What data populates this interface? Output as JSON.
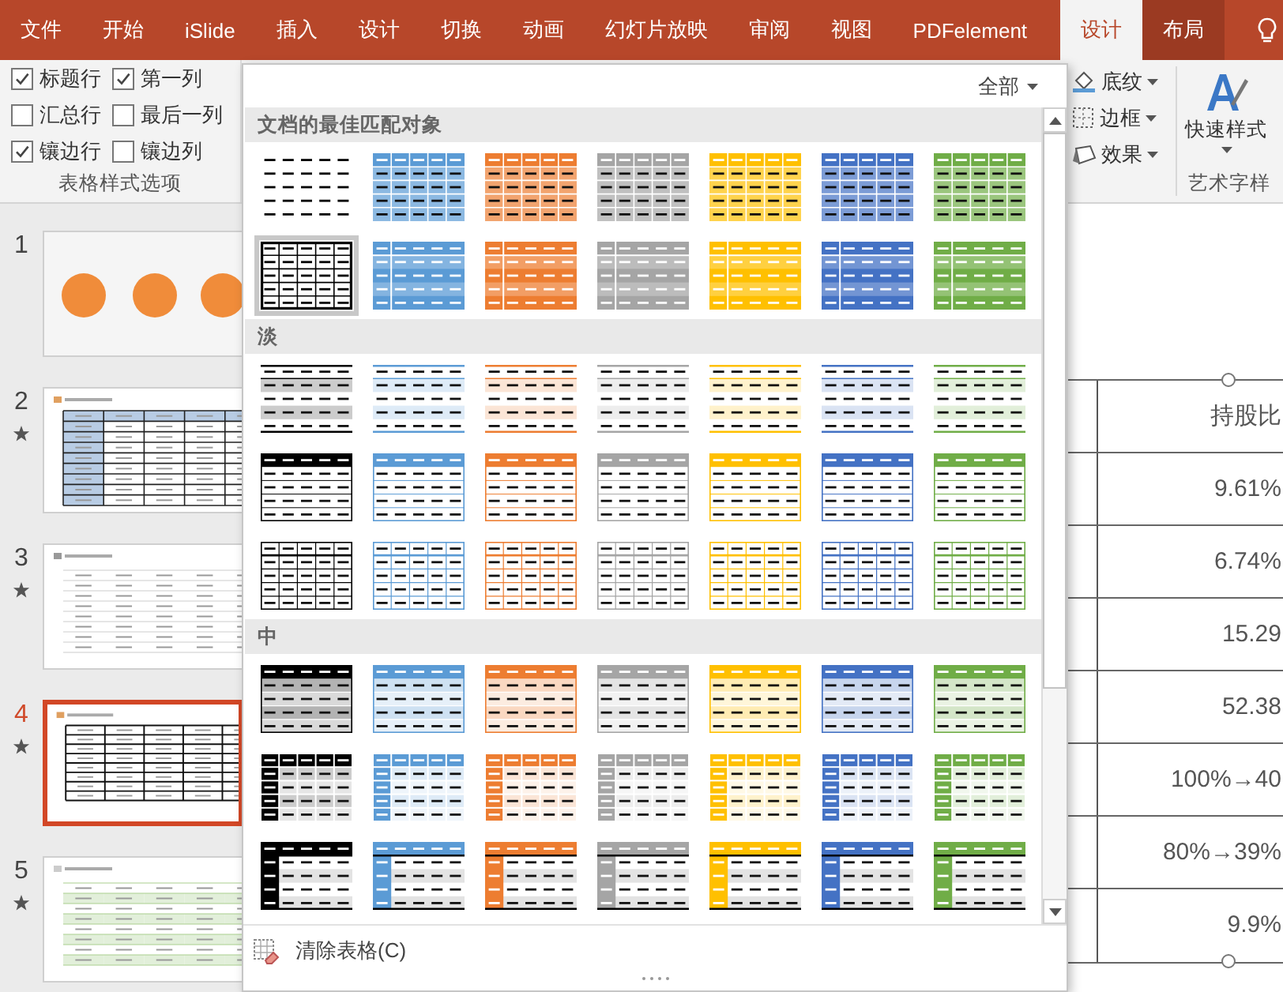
{
  "tabs": [
    {
      "label": "文件",
      "selected": false,
      "contextual": false
    },
    {
      "label": "开始",
      "selected": false,
      "contextual": false
    },
    {
      "label": "iSlide",
      "selected": false,
      "contextual": false
    },
    {
      "label": "插入",
      "selected": false,
      "contextual": false
    },
    {
      "label": "设计",
      "selected": false,
      "contextual": false
    },
    {
      "label": "切换",
      "selected": false,
      "contextual": false
    },
    {
      "label": "动画",
      "selected": false,
      "contextual": false
    },
    {
      "label": "幻灯片放映",
      "selected": false,
      "contextual": false
    },
    {
      "label": "审阅",
      "selected": false,
      "contextual": false
    },
    {
      "label": "视图",
      "selected": false,
      "contextual": false
    },
    {
      "label": "PDFelement",
      "selected": false,
      "contextual": false
    },
    {
      "label": "设计",
      "selected": true,
      "contextual": false
    },
    {
      "label": "布局",
      "selected": false,
      "contextual": true
    }
  ],
  "table_style_options": {
    "options": [
      {
        "label": "标题行",
        "checked": true
      },
      {
        "label": "第一列",
        "checked": true
      },
      {
        "label": "汇总行",
        "checked": false
      },
      {
        "label": "最后一列",
        "checked": false
      },
      {
        "label": "镶边行",
        "checked": true
      },
      {
        "label": "镶边列",
        "checked": false
      }
    ],
    "group_label": "表格样式选项"
  },
  "table_format_buttons": [
    {
      "label": "底纹",
      "kind": "shading"
    },
    {
      "label": "边框",
      "kind": "borders"
    },
    {
      "label": "效果",
      "kind": "effects"
    }
  ],
  "wordart": {
    "quick_styles_label": "快速样式",
    "group_label": "艺术字样"
  },
  "slides": [
    {
      "number": "1",
      "starred": false,
      "selected": false,
      "kind": "circles"
    },
    {
      "number": "2",
      "starred": true,
      "selected": false,
      "kind": "blue-table"
    },
    {
      "number": "3",
      "starred": true,
      "selected": false,
      "kind": "plain-table"
    },
    {
      "number": "4",
      "starred": true,
      "selected": true,
      "kind": "grid-table"
    },
    {
      "number": "5",
      "starred": true,
      "selected": false,
      "kind": "green-table"
    }
  ],
  "slide_table": {
    "header": "持股比",
    "cells": [
      "9.61%",
      "6.74%",
      "15.29",
      "52.38",
      "100%→40",
      "80%→39%",
      "9.9%"
    ]
  },
  "style_gallery": {
    "filter": "全部",
    "clear_label": "清除表格(C)",
    "sections": [
      {
        "title": "文档的最佳匹配对象",
        "rows": [
          [
            {
              "kind": "plain",
              "color": "#000000",
              "selected": false
            },
            {
              "kind": "fill-grid",
              "color": "#5b9bd5",
              "selected": false
            },
            {
              "kind": "fill-grid",
              "color": "#ed7d31",
              "selected": false
            },
            {
              "kind": "fill-grid",
              "color": "#a5a5a5",
              "selected": false
            },
            {
              "kind": "fill-grid",
              "color": "#ffc000",
              "selected": false
            },
            {
              "kind": "fill-grid",
              "color": "#4472c4",
              "selected": false
            },
            {
              "kind": "fill-grid",
              "color": "#70ad47",
              "selected": false
            }
          ],
          [
            {
              "kind": "grid",
              "color": "#000000",
              "selected": true
            },
            {
              "kind": "fill-banded",
              "color": "#5b9bd5",
              "selected": false
            },
            {
              "kind": "fill-banded",
              "color": "#ed7d31",
              "selected": false
            },
            {
              "kind": "fill-banded",
              "color": "#a5a5a5",
              "selected": false
            },
            {
              "kind": "fill-banded",
              "color": "#ffc000",
              "selected": false
            },
            {
              "kind": "fill-banded",
              "color": "#4472c4",
              "selected": false
            },
            {
              "kind": "fill-banded",
              "color": "#70ad47",
              "selected": false
            }
          ]
        ]
      },
      {
        "title": "淡",
        "rows": [
          [
            {
              "kind": "light-lines",
              "color": "#000000",
              "selected": false
            },
            {
              "kind": "light-lines",
              "color": "#5b9bd5",
              "selected": false
            },
            {
              "kind": "light-lines",
              "color": "#ed7d31",
              "selected": false
            },
            {
              "kind": "light-lines",
              "color": "#a5a5a5",
              "selected": false
            },
            {
              "kind": "light-lines",
              "color": "#ffc000",
              "selected": false
            },
            {
              "kind": "light-lines",
              "color": "#4472c4",
              "selected": false
            },
            {
              "kind": "light-lines",
              "color": "#70ad47",
              "selected": false
            }
          ],
          [
            {
              "kind": "light-header",
              "color": "#000000",
              "selected": false
            },
            {
              "kind": "light-header",
              "color": "#5b9bd5",
              "selected": false
            },
            {
              "kind": "light-header",
              "color": "#ed7d31",
              "selected": false
            },
            {
              "kind": "light-header",
              "color": "#a5a5a5",
              "selected": false
            },
            {
              "kind": "light-header",
              "color": "#ffc000",
              "selected": false
            },
            {
              "kind": "light-header",
              "color": "#4472c4",
              "selected": false
            },
            {
              "kind": "light-header",
              "color": "#70ad47",
              "selected": false
            }
          ],
          [
            {
              "kind": "light-grid",
              "color": "#000000",
              "selected": false
            },
            {
              "kind": "light-grid",
              "color": "#5b9bd5",
              "selected": false
            },
            {
              "kind": "light-grid",
              "color": "#ed7d31",
              "selected": false
            },
            {
              "kind": "light-grid",
              "color": "#a5a5a5",
              "selected": false
            },
            {
              "kind": "light-grid",
              "color": "#ffc000",
              "selected": false
            },
            {
              "kind": "light-grid",
              "color": "#4472c4",
              "selected": false
            },
            {
              "kind": "light-grid",
              "color": "#70ad47",
              "selected": false
            }
          ]
        ]
      },
      {
        "title": "中",
        "rows": [
          [
            {
              "kind": "medium-header",
              "color": "#000000",
              "selected": false
            },
            {
              "kind": "medium-header",
              "color": "#5b9bd5",
              "selected": false
            },
            {
              "kind": "medium-header",
              "color": "#ed7d31",
              "selected": false
            },
            {
              "kind": "medium-header",
              "color": "#a5a5a5",
              "selected": false
            },
            {
              "kind": "medium-header",
              "color": "#ffc000",
              "selected": false
            },
            {
              "kind": "medium-header",
              "color": "#4472c4",
              "selected": false
            },
            {
              "kind": "medium-header",
              "color": "#70ad47",
              "selected": false
            }
          ],
          [
            {
              "kind": "medium-cells",
              "color": "#000000",
              "selected": false
            },
            {
              "kind": "medium-cells",
              "color": "#5b9bd5",
              "selected": false
            },
            {
              "kind": "medium-cells",
              "color": "#ed7d31",
              "selected": false
            },
            {
              "kind": "medium-cells",
              "color": "#a5a5a5",
              "selected": false
            },
            {
              "kind": "medium-cells",
              "color": "#ffc000",
              "selected": false
            },
            {
              "kind": "medium-cells",
              "color": "#4472c4",
              "selected": false
            },
            {
              "kind": "medium-cells",
              "color": "#70ad47",
              "selected": false
            }
          ],
          [
            {
              "kind": "medium-first-col",
              "color": "#000000",
              "selected": false
            },
            {
              "kind": "medium-first-col",
              "color": "#5b9bd5",
              "selected": false
            },
            {
              "kind": "medium-first-col",
              "color": "#ed7d31",
              "selected": false
            },
            {
              "kind": "medium-first-col",
              "color": "#a5a5a5",
              "selected": false
            },
            {
              "kind": "medium-first-col",
              "color": "#ffc000",
              "selected": false
            },
            {
              "kind": "medium-first-col",
              "color": "#4472c4",
              "selected": false
            },
            {
              "kind": "medium-first-col",
              "color": "#70ad47",
              "selected": false
            }
          ]
        ]
      }
    ]
  }
}
